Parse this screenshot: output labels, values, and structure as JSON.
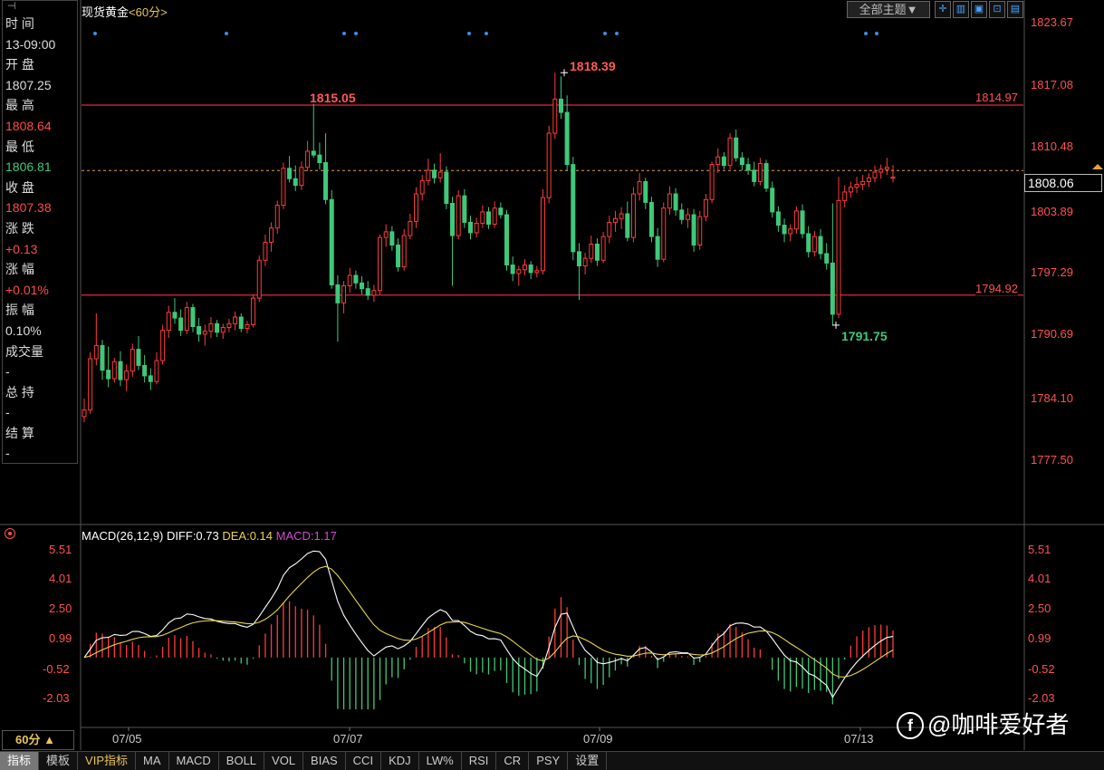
{
  "header": {
    "instrument": "现货黄金",
    "period": "<60分>",
    "theme_button": "全部主题▼",
    "tools": [
      "✛",
      "▥",
      "▣",
      "⊡",
      "▤"
    ]
  },
  "info_panel": {
    "rows": [
      {
        "label": "时 间",
        "value": "13-09:00",
        "value_color": "white"
      },
      {
        "label": "开 盘",
        "value": "1807.25",
        "value_color": "white"
      },
      {
        "label": "最 高",
        "value": "1808.64",
        "value_color": "red"
      },
      {
        "label": "最 低",
        "value": "1806.81",
        "value_color": "green"
      },
      {
        "label": "收 盘",
        "value": "1807.38",
        "value_color": "red"
      },
      {
        "label": "涨 跌",
        "value": "+0.13",
        "value_color": "red"
      },
      {
        "label": "涨 幅",
        "value": "+0.01%",
        "value_color": "red"
      },
      {
        "label": "振 幅",
        "value": "0.10%",
        "value_color": "white"
      },
      {
        "label": "成交量",
        "value": "-",
        "value_color": "white"
      },
      {
        "label": "总 持",
        "value": "-",
        "value_color": "white"
      },
      {
        "label": "结 算",
        "value": "-",
        "value_color": "white"
      }
    ]
  },
  "price_axis": [
    "1823.67",
    "1817.08",
    "1810.48",
    "1803.89",
    "1797.29",
    "1790.69",
    "1784.10",
    "1777.50"
  ],
  "current_price": "1808.06",
  "levels": {
    "resistance": "1814.97",
    "support": "1794.92"
  },
  "annotations": {
    "high_left": "1815.05",
    "high_peak": "1818.39",
    "low": "1791.75"
  },
  "macd": {
    "name": "MACD(26,12,9)",
    "diff": "DIFF:0.73",
    "dea": "DEA:0.14",
    "macd": "MACD:1.17",
    "axis": [
      "5.51",
      "4.01",
      "2.50",
      "0.99",
      "-0.52",
      "-2.03"
    ]
  },
  "dates": [
    "07/05",
    "07/07",
    "07/09",
    "07/13"
  ],
  "period_selector": "60分 ▲",
  "tabs": [
    "指标",
    "模板",
    "VIP指标",
    "MA",
    "MACD",
    "BOLL",
    "VOL",
    "BIAS",
    "CCI",
    "KDJ",
    "LW%",
    "RSI",
    "CR",
    "PSY",
    "设置"
  ],
  "watermark": "@咖啡爱好者",
  "colors": {
    "up": "#ff3b3b",
    "down": "#3ec97a",
    "level": "#e0283c",
    "diff": "#ffffff",
    "dea": "#e8d44a"
  },
  "chart_data": {
    "type": "candlestick",
    "price_range": [
      1777.5,
      1823.67
    ],
    "candles": [
      [
        1782.1,
        1784.0,
        1781.5,
        1782.8
      ],
      [
        1782.8,
        1788.9,
        1782.4,
        1788.2
      ],
      [
        1788.2,
        1793.0,
        1787.5,
        1789.6
      ],
      [
        1789.6,
        1790.2,
        1786.0,
        1787.0
      ],
      [
        1787.0,
        1789.5,
        1785.2,
        1786.1
      ],
      [
        1786.1,
        1788.3,
        1785.7,
        1787.9
      ],
      [
        1787.9,
        1789.0,
        1785.3,
        1786.0
      ],
      [
        1786.0,
        1787.6,
        1784.8,
        1786.9
      ],
      [
        1786.9,
        1789.8,
        1786.3,
        1789.2
      ],
      [
        1789.2,
        1790.6,
        1787.0,
        1787.5
      ],
      [
        1787.5,
        1788.6,
        1785.7,
        1786.4
      ],
      [
        1786.4,
        1787.2,
        1784.9,
        1785.8
      ],
      [
        1785.8,
        1788.9,
        1785.5,
        1788.0
      ],
      [
        1788.0,
        1791.8,
        1787.6,
        1791.2
      ],
      [
        1791.2,
        1793.8,
        1790.4,
        1793.1
      ],
      [
        1793.1,
        1794.6,
        1791.9,
        1792.5
      ],
      [
        1792.5,
        1793.4,
        1790.6,
        1791.2
      ],
      [
        1791.2,
        1794.2,
        1790.8,
        1793.6
      ],
      [
        1793.6,
        1794.0,
        1791.0,
        1791.6
      ],
      [
        1791.6,
        1792.5,
        1790.0,
        1790.8
      ],
      [
        1790.8,
        1791.8,
        1789.6,
        1791.1
      ],
      [
        1791.1,
        1792.6,
        1790.4,
        1791.9
      ],
      [
        1791.9,
        1792.3,
        1790.5,
        1791.0
      ],
      [
        1791.0,
        1791.9,
        1790.3,
        1791.5
      ],
      [
        1791.5,
        1792.4,
        1791.0,
        1791.9
      ],
      [
        1791.9,
        1793.2,
        1791.2,
        1792.6
      ],
      [
        1792.6,
        1793.0,
        1791.0,
        1791.4
      ],
      [
        1791.4,
        1792.2,
        1790.9,
        1791.8
      ],
      [
        1791.8,
        1795.0,
        1791.5,
        1794.6
      ],
      [
        1794.6,
        1799.1,
        1794.2,
        1798.6
      ],
      [
        1798.6,
        1801.3,
        1798.0,
        1800.5
      ],
      [
        1800.5,
        1802.6,
        1799.5,
        1802.0
      ],
      [
        1802.0,
        1804.9,
        1801.4,
        1804.4
      ],
      [
        1804.4,
        1808.9,
        1804.0,
        1808.3
      ],
      [
        1808.3,
        1809.6,
        1806.8,
        1807.2
      ],
      [
        1807.2,
        1808.6,
        1805.9,
        1806.5
      ],
      [
        1806.5,
        1809.0,
        1806.0,
        1808.4
      ],
      [
        1808.4,
        1811.2,
        1808.0,
        1810.1
      ],
      [
        1810.1,
        1815.1,
        1809.4,
        1809.7
      ],
      [
        1809.7,
        1811.0,
        1808.2,
        1808.9
      ],
      [
        1808.9,
        1812.0,
        1804.5,
        1805.0
      ],
      [
        1805.0,
        1806.0,
        1795.6,
        1796.0
      ],
      [
        1796.0,
        1797.0,
        1790.0,
        1794.1
      ],
      [
        1794.1,
        1796.4,
        1793.0,
        1795.9
      ],
      [
        1795.9,
        1797.8,
        1795.2,
        1797.0
      ],
      [
        1797.0,
        1797.5,
        1795.6,
        1796.2
      ],
      [
        1796.2,
        1796.9,
        1795.0,
        1795.6
      ],
      [
        1795.6,
        1796.4,
        1794.4,
        1794.9
      ],
      [
        1794.9,
        1796.0,
        1794.2,
        1795.4
      ],
      [
        1795.4,
        1801.3,
        1795.0,
        1801.0
      ],
      [
        1801.0,
        1802.4,
        1800.0,
        1801.6
      ],
      [
        1801.6,
        1802.2,
        1799.6,
        1800.2
      ],
      [
        1800.2,
        1800.9,
        1797.4,
        1797.9
      ],
      [
        1797.9,
        1801.9,
        1797.5,
        1801.2
      ],
      [
        1801.2,
        1803.5,
        1800.8,
        1802.7
      ],
      [
        1802.7,
        1806.3,
        1802.0,
        1805.6
      ],
      [
        1805.6,
        1807.6,
        1804.9,
        1807.0
      ],
      [
        1807.0,
        1809.3,
        1806.5,
        1808.1
      ],
      [
        1808.1,
        1808.8,
        1806.7,
        1807.3
      ],
      [
        1807.3,
        1809.9,
        1806.8,
        1807.9
      ],
      [
        1807.9,
        1808.5,
        1804.0,
        1804.6
      ],
      [
        1804.6,
        1805.3,
        1795.9,
        1801.2
      ],
      [
        1801.2,
        1806.0,
        1800.8,
        1805.4
      ],
      [
        1805.4,
        1806.1,
        1802.0,
        1802.6
      ],
      [
        1802.6,
        1803.3,
        1800.8,
        1801.5
      ],
      [
        1801.5,
        1803.1,
        1801.0,
        1802.5
      ],
      [
        1802.5,
        1804.4,
        1802.0,
        1803.7
      ],
      [
        1803.7,
        1804.2,
        1801.9,
        1802.4
      ],
      [
        1802.4,
        1804.8,
        1802.0,
        1804.1
      ],
      [
        1804.1,
        1804.7,
        1803.0,
        1803.4
      ],
      [
        1803.4,
        1803.9,
        1797.5,
        1798.1
      ],
      [
        1798.1,
        1799.0,
        1796.4,
        1797.2
      ],
      [
        1797.2,
        1798.0,
        1795.9,
        1797.6
      ],
      [
        1797.6,
        1798.7,
        1797.0,
        1798.1
      ],
      [
        1798.1,
        1798.5,
        1796.6,
        1797.3
      ],
      [
        1797.3,
        1798.0,
        1796.8,
        1797.5
      ],
      [
        1797.5,
        1806.1,
        1797.1,
        1805.2
      ],
      [
        1805.2,
        1812.8,
        1804.6,
        1812.0
      ],
      [
        1812.0,
        1818.4,
        1811.4,
        1815.6
      ],
      [
        1815.6,
        1818.0,
        1813.5,
        1814.2
      ],
      [
        1814.2,
        1816.0,
        1808.0,
        1808.7
      ],
      [
        1808.7,
        1809.5,
        1798.6,
        1799.5
      ],
      [
        1799.5,
        1800.4,
        1794.4,
        1798.0
      ],
      [
        1798.0,
        1799.4,
        1797.1,
        1798.8
      ],
      [
        1798.8,
        1801.2,
        1798.3,
        1800.3
      ],
      [
        1800.3,
        1800.9,
        1798.0,
        1798.6
      ],
      [
        1798.6,
        1801.6,
        1798.3,
        1801.1
      ],
      [
        1801.1,
        1803.3,
        1800.4,
        1802.6
      ],
      [
        1802.6,
        1803.8,
        1801.6,
        1803.0
      ],
      [
        1803.0,
        1804.2,
        1801.9,
        1803.5
      ],
      [
        1803.5,
        1804.8,
        1800.6,
        1801.0
      ],
      [
        1801.0,
        1806.3,
        1800.5,
        1805.6
      ],
      [
        1805.6,
        1807.8,
        1804.9,
        1806.9
      ],
      [
        1806.9,
        1807.3,
        1804.0,
        1804.7
      ],
      [
        1804.7,
        1805.3,
        1800.5,
        1801.1
      ],
      [
        1801.1,
        1802.0,
        1797.9,
        1798.7
      ],
      [
        1798.7,
        1804.7,
        1798.4,
        1804.1
      ],
      [
        1804.1,
        1806.4,
        1803.4,
        1805.6
      ],
      [
        1805.6,
        1806.2,
        1803.3,
        1803.9
      ],
      [
        1803.9,
        1804.6,
        1802.4,
        1802.9
      ],
      [
        1802.9,
        1804.1,
        1802.0,
        1803.4
      ],
      [
        1803.4,
        1804.0,
        1799.5,
        1800.2
      ],
      [
        1800.2,
        1803.8,
        1799.7,
        1803.2
      ],
      [
        1803.2,
        1805.6,
        1802.7,
        1805.0
      ],
      [
        1805.0,
        1809.0,
        1804.6,
        1808.7
      ],
      [
        1808.7,
        1810.4,
        1807.8,
        1809.5
      ],
      [
        1809.5,
        1810.0,
        1808.2,
        1808.6
      ],
      [
        1808.6,
        1812.0,
        1808.2,
        1811.5
      ],
      [
        1811.5,
        1812.4,
        1809.0,
        1809.4
      ],
      [
        1809.4,
        1810.0,
        1808.1,
        1808.7
      ],
      [
        1808.7,
        1809.4,
        1807.6,
        1808.1
      ],
      [
        1808.1,
        1809.0,
        1806.4,
        1806.9
      ],
      [
        1806.9,
        1809.4,
        1806.5,
        1808.8
      ],
      [
        1808.8,
        1809.2,
        1805.8,
        1806.2
      ],
      [
        1806.2,
        1806.9,
        1803.1,
        1803.7
      ],
      [
        1803.7,
        1804.3,
        1801.6,
        1802.3
      ],
      [
        1802.3,
        1803.0,
        1800.5,
        1801.4
      ],
      [
        1801.4,
        1802.4,
        1800.6,
        1801.9
      ],
      [
        1801.9,
        1804.3,
        1801.4,
        1803.8
      ],
      [
        1803.8,
        1804.5,
        1800.9,
        1801.4
      ],
      [
        1801.4,
        1802.2,
        1798.9,
        1799.5
      ],
      [
        1799.5,
        1801.7,
        1799.0,
        1801.1
      ],
      [
        1801.1,
        1801.9,
        1798.7,
        1799.3
      ],
      [
        1799.3,
        1800.4,
        1797.6,
        1798.3
      ],
      [
        1798.3,
        1804.6,
        1791.7,
        1792.9
      ],
      [
        1792.9,
        1807.4,
        1792.5,
        1804.9
      ],
      [
        1804.9,
        1806.5,
        1804.2,
        1805.8
      ],
      [
        1805.8,
        1806.9,
        1805.2,
        1806.3
      ],
      [
        1806.3,
        1807.4,
        1805.7,
        1806.6
      ],
      [
        1806.6,
        1807.6,
        1806.0,
        1806.9
      ],
      [
        1806.9,
        1807.8,
        1806.3,
        1807.3
      ],
      [
        1807.3,
        1808.6,
        1806.8,
        1807.9
      ],
      [
        1807.9,
        1808.7,
        1807.2,
        1808.2
      ],
      [
        1808.2,
        1809.4,
        1807.6,
        1808.4
      ],
      [
        1807.25,
        1808.64,
        1806.81,
        1807.38
      ]
    ]
  }
}
